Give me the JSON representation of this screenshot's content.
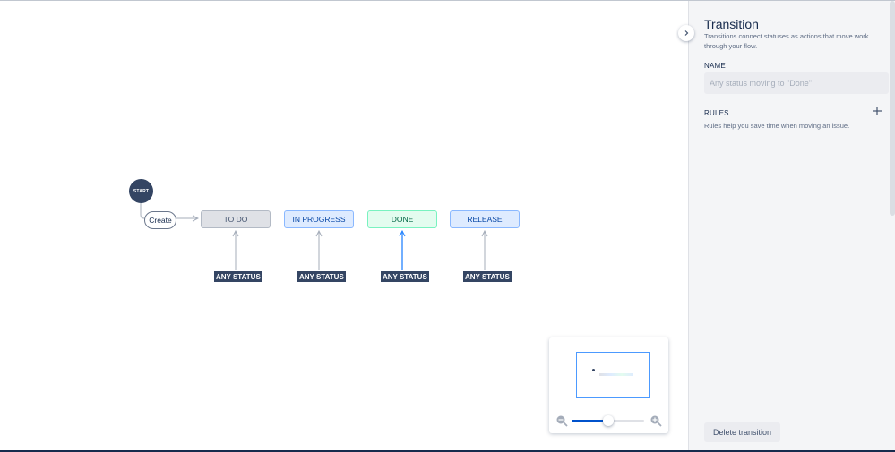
{
  "workflow": {
    "start_label": "START",
    "create_label": "Create",
    "statuses": [
      {
        "label": "TO DO",
        "category": "todo"
      },
      {
        "label": "IN PROGRESS",
        "category": "in-progress"
      },
      {
        "label": "DONE",
        "category": "done"
      },
      {
        "label": "RELEASE",
        "category": "in-progress"
      }
    ],
    "any_status_label": "ANY STATUS"
  },
  "minimap": {
    "zoom_level": 0.5,
    "zoom_out_icon": "zoom-out-icon",
    "zoom_in_icon": "zoom-in-icon"
  },
  "panel": {
    "collapse_icon": "chevron-right-icon",
    "title": "Transition",
    "description": "Transitions connect statuses as actions that move work through your flow.",
    "name_label": "NAME",
    "name_placeholder": "Any status moving to \"Done\"",
    "name_value": "",
    "rules_label": "RULES",
    "rules_description": "Rules help you save time when moving an issue.",
    "add_rule_icon": "plus-icon",
    "delete_label": "Delete transition"
  },
  "colors": {
    "accent": "#0052cc",
    "selected_edge": "#2684ff",
    "todo": "#dfe1e6",
    "in_progress": "#deebff",
    "done": "#e3fcef",
    "dark": "#344563"
  }
}
